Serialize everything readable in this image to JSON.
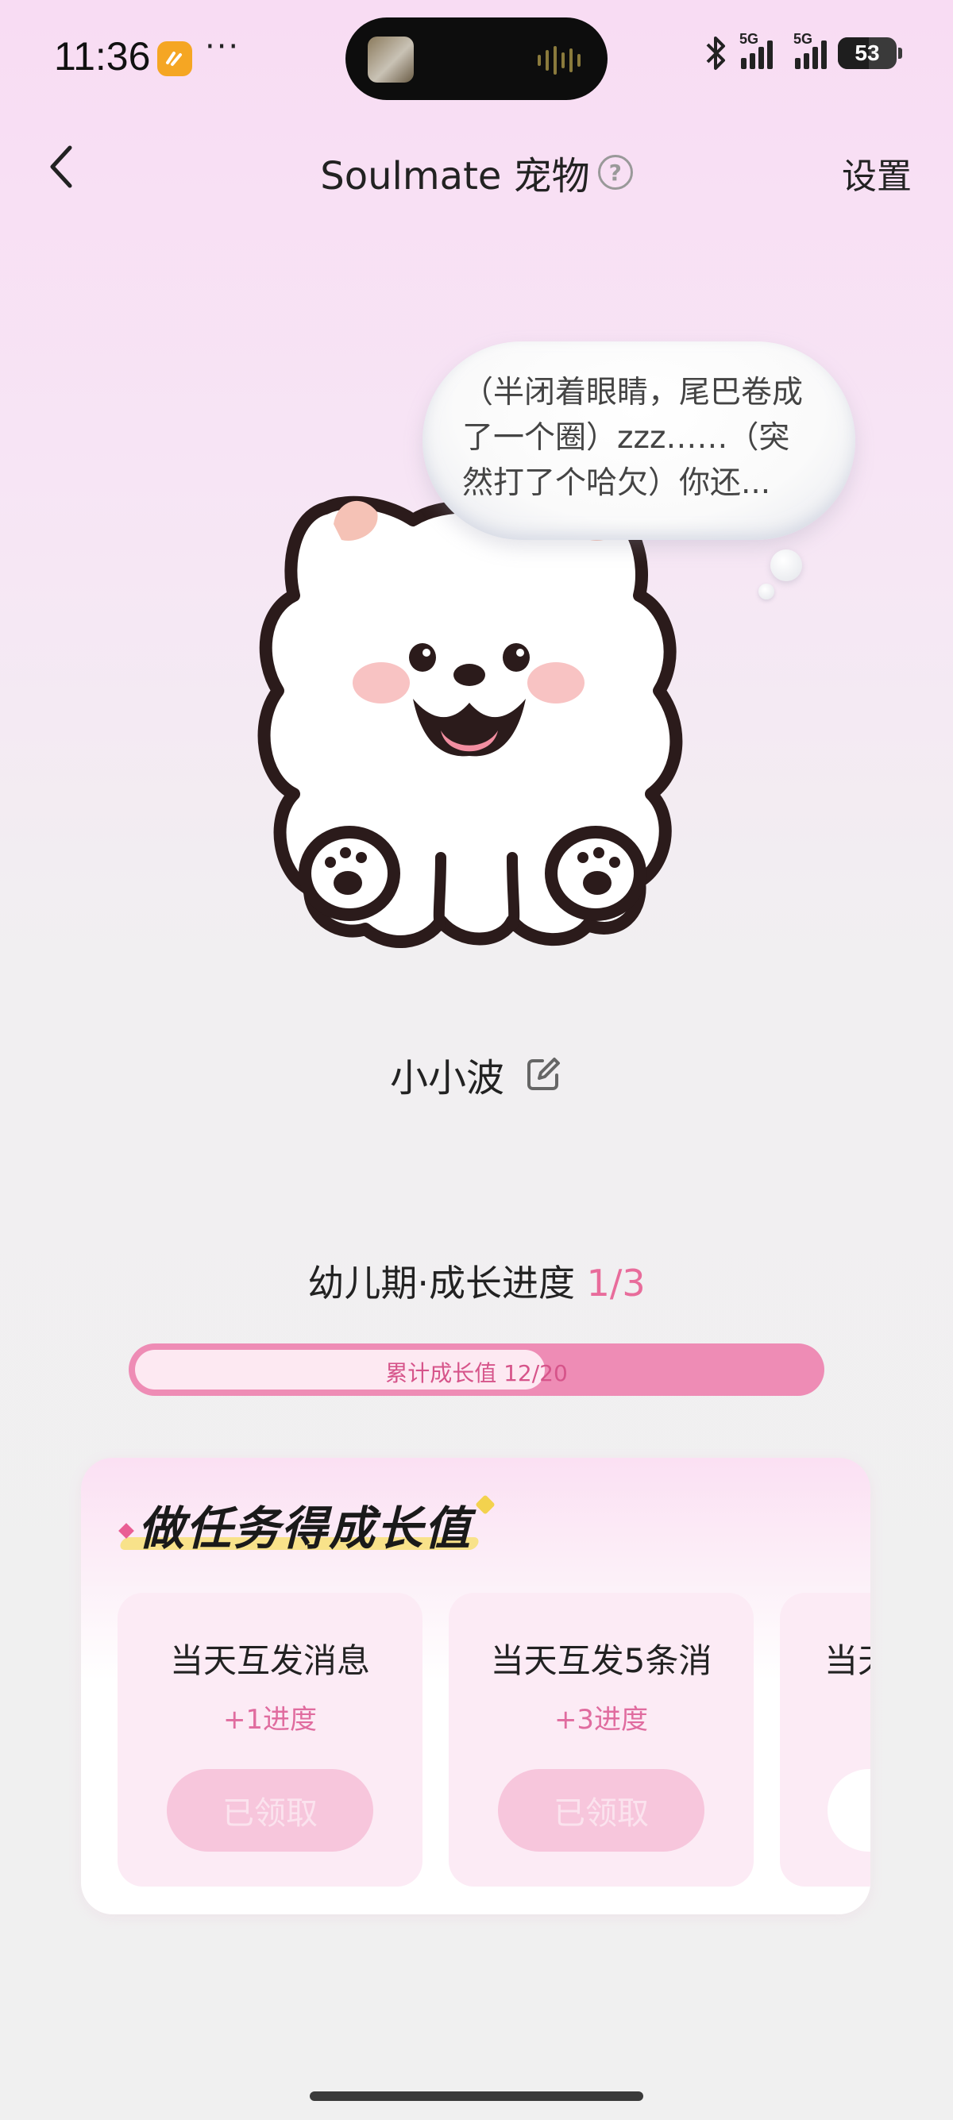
{
  "status_bar": {
    "time": "11:36",
    "more": "···",
    "network_1": "5G",
    "network_2": "5G",
    "battery_level": "53",
    "battery_percent": 0.53
  },
  "nav": {
    "title": "Soulmate 宠物",
    "help_glyph": "?",
    "settings_label": "设置"
  },
  "pet": {
    "speech": "（半闭着眼睛，尾巴卷成了一个圈）zzz……（突然打了个哈欠）你还...",
    "name": "小小波"
  },
  "growth": {
    "stage_label": "幼儿期·成长进度 ",
    "stage_progress": "1/3",
    "progress_text": "累计成长值 12/20",
    "progress_value": 12,
    "progress_max": 20
  },
  "tasks": {
    "header": "做任务得成长值",
    "items": [
      {
        "name": "当天互发消息",
        "reward": "+1进度",
        "button": "已领取"
      },
      {
        "name": "当天互发5条消",
        "reward": "+3进度",
        "button": "已领取"
      },
      {
        "name": "当天",
        "reward": "",
        "button": ""
      }
    ]
  },
  "colors": {
    "accent": "#e86c9b",
    "progress_track": "#ee8cb5",
    "progress_fill": "#fde9f2",
    "claimed_button": "#f7c6dc"
  }
}
